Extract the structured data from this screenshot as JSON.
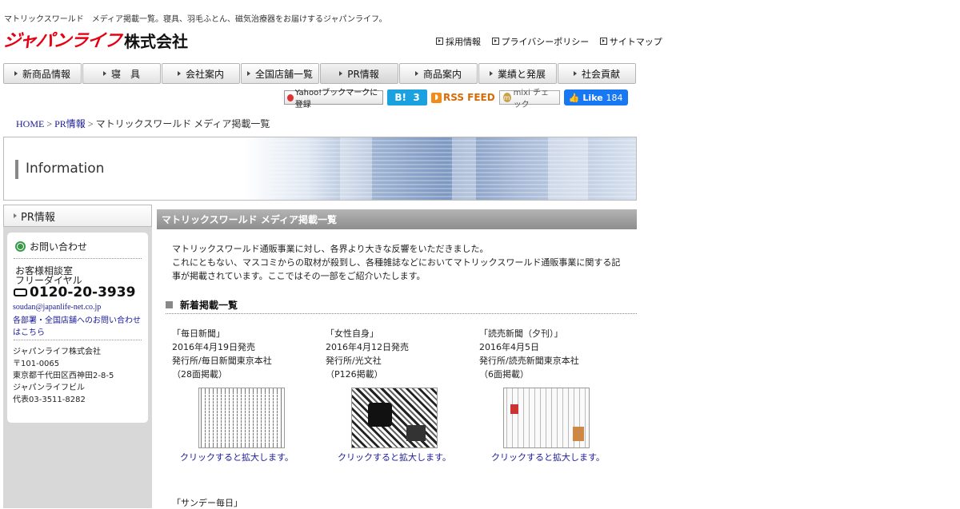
{
  "tagline": "マトリックスワールド　メディア掲載一覧。寝具、羽毛ふとん、磁気治療器をお届けするジャパンライフ。",
  "logo": {
    "brand": "ジャパンライフ",
    "corp": "株式会社"
  },
  "top_links": [
    "採用情報",
    "プライバシーポリシー",
    "サイトマップ"
  ],
  "global_nav": [
    {
      "label": "新商品情報"
    },
    {
      "label": "寝　具"
    },
    {
      "label": "会社案内"
    },
    {
      "label": "全国店舗一覧"
    },
    {
      "label": "PR情報",
      "active": true
    },
    {
      "label": "商品案内"
    },
    {
      "label": "業績と発展"
    },
    {
      "label": "社会貢献"
    }
  ],
  "social": {
    "yahoo": "Yahoo!ブックマークに登録",
    "hatena_label": "B!",
    "hatena_count": "3",
    "rss": "RSS FEED",
    "mixi": "mixi チェック",
    "like_label": "Like",
    "like_count": "184"
  },
  "breadcrumb": {
    "home": "HOME",
    "sep": ">",
    "pr": "PR情報",
    "current": "マトリックスワールド メディア掲載一覧"
  },
  "banner": {
    "title": "Information"
  },
  "sidebar": {
    "head": "PR情報",
    "contact_title": "お問い合わせ",
    "consult_line1": "お客様相談室",
    "consult_line2": "フリーダイヤル",
    "phone": "0120-20-3939",
    "email": "soudan@japanlife-net.co.jp",
    "dept_link": "各部署・全国店舗へのお問い合わせはこちら",
    "company": "ジャパンライフ株式会社",
    "zip": "〒101-0065",
    "address": "東京都千代田区西神田2-8-5",
    "building": "ジャパンライフビル",
    "tel": "代表03-3511-8282"
  },
  "main": {
    "heading": "マトリックスワールド メディア掲載一覧",
    "intro_1": "マトリックスワールド通販事業に対し、各界より大きな反響をいただきました。",
    "intro_2": "これにともない、マスコミからの取材が殺到し、各種雑誌などにおいてマトリックスワールド通販事業に関する記事が掲載されています。ここではその一部をご紹介いたします。",
    "section_title": "新着掲載一覧",
    "click_label": "クリックすると拡大します。",
    "articles": [
      {
        "name": "「毎日新聞」",
        "date": "2016年4月19日発売",
        "publisher": "発行所/毎日新聞東京本社",
        "page": "（28面掲載）"
      },
      {
        "name": "「女性自身」",
        "date": "2016年4月12日発売",
        "publisher": "発行所/光文社",
        "page": "（P126掲載）"
      },
      {
        "name": "「読売新聞（夕刊）」",
        "date": "2016年4月5日",
        "publisher": "発行所/読売新聞東京本社",
        "page": "（6面掲載）"
      }
    ],
    "next_article": "「サンデー毎日」"
  }
}
